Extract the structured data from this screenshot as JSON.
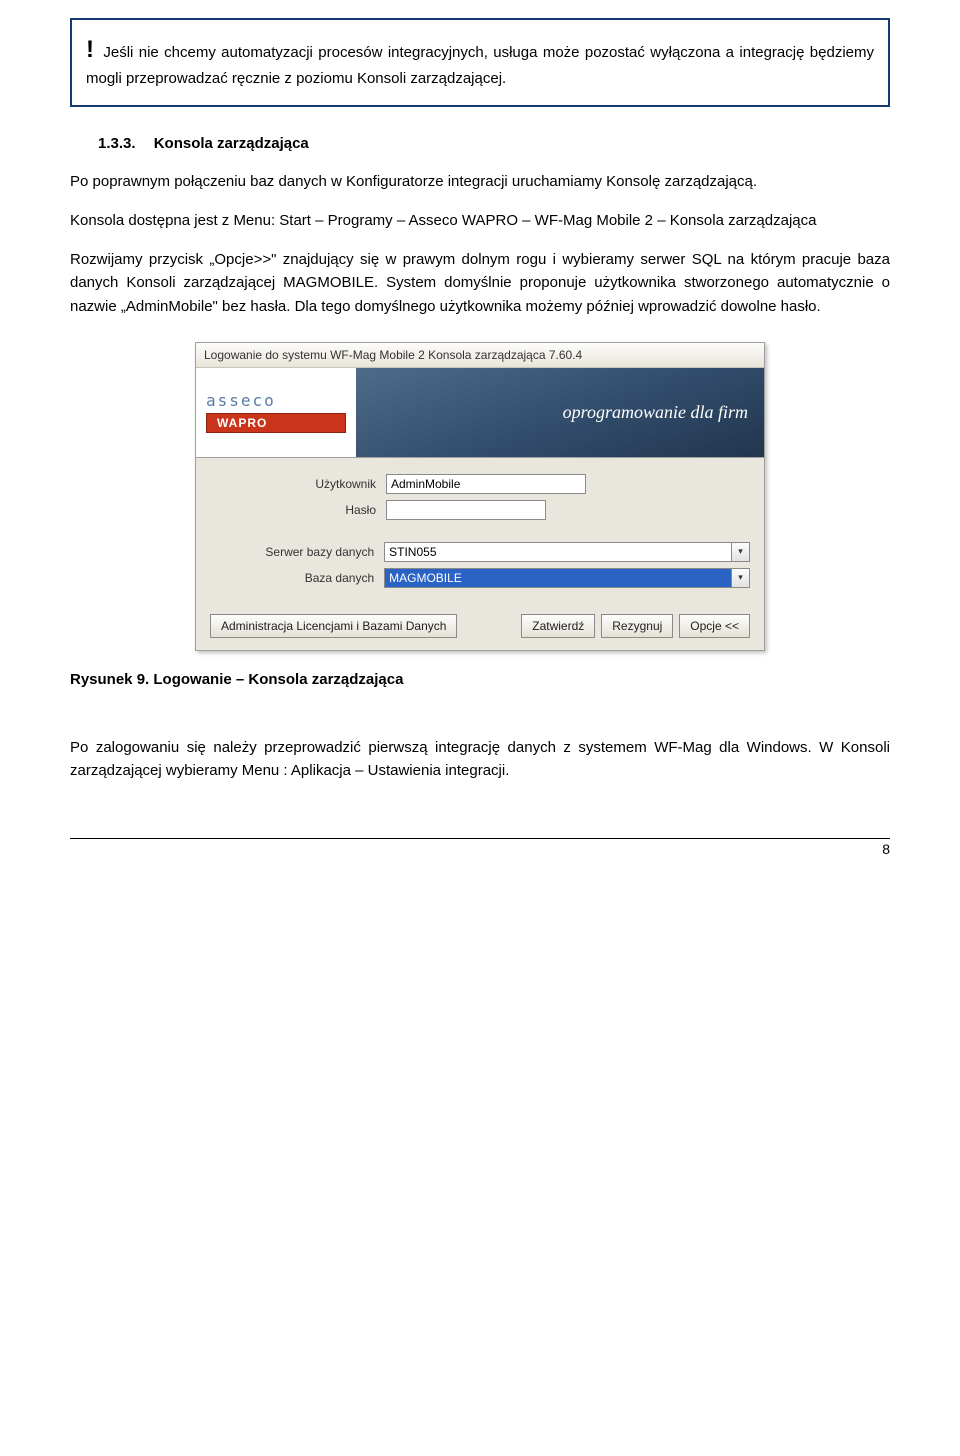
{
  "note": "Jeśli nie chcemy automatyzacji procesów integracyjnych, usługa może pozostać wyłączona a integrację będziemy mogli przeprowadzać ręcznie z poziomu Konsoli zarządzającej.",
  "heading": {
    "number": "1.3.3.",
    "title": "Konsola zarządzająca"
  },
  "para1": "Po poprawnym połączeniu baz danych w Konfiguratorze integracji uruchamiamy Konsolę zarządzającą.",
  "para2": "Konsola dostępna jest z Menu: Start – Programy – Asseco WAPRO – WF-Mag Mobile 2 – Konsola zarządzająca",
  "para3": "Rozwijamy przycisk „Opcje>>\" znajdujący się w prawym dolnym rogu i wybieramy serwer SQL na którym pracuje baza danych Konsoli zarządzającej MAGMOBILE. System domyślnie proponuje użytkownika stworzonego automatycznie o nazwie „AdminMobile\" bez hasła. Dla tego domyślnego użytkownika możemy później wprowadzić dowolne hasło.",
  "login": {
    "title": "Logowanie do systemu WF-Mag Mobile 2 Konsola zarządzająca 7.60.4",
    "assecoText": "asseco",
    "wapro": "WAPRO",
    "slogan": "oprogramowanie dla firm",
    "userLabel": "Użytkownik",
    "userValue": "AdminMobile",
    "passLabel": "Hasło",
    "serverLabel": "Serwer bazy danych",
    "serverValue": "STIN055",
    "dbLabel": "Baza danych",
    "dbValue": "MAGMOBILE",
    "adminBtn": "Administracja Licencjami i Bazami Danych",
    "ok": "Zatwierdź",
    "cancel": "Rezygnuj",
    "opts": "Opcje <<"
  },
  "figCaption": "Rysunek 9. Logowanie – Konsola zarządzająca",
  "para4": "Po zalogowaniu się należy przeprowadzić pierwszą integrację danych z systemem WF-Mag dla Windows. W Konsoli zarządzającej wybieramy Menu : Aplikacja – Ustawienia integracji.",
  "pageNum": "8"
}
